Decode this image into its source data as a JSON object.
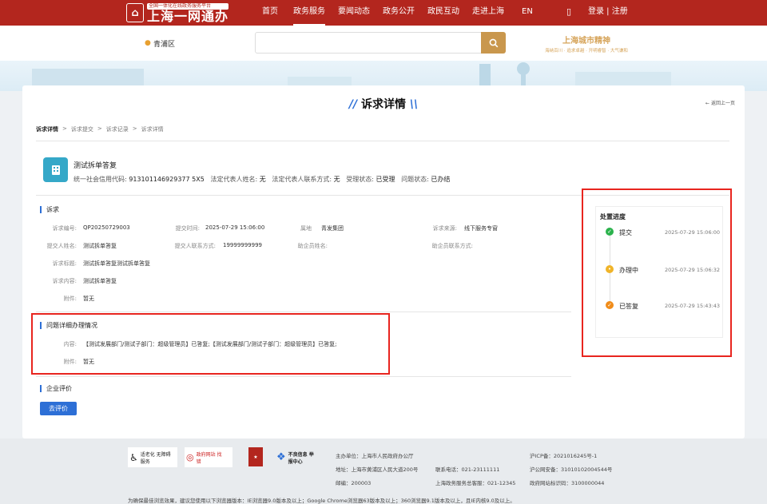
{
  "header": {
    "logo_small": "全国一体化在线政务服务平台",
    "logo_title": "上海一网通办",
    "nav": [
      "首页",
      "政务服务",
      "要闻动态",
      "政务公开",
      "政民互动",
      "走进上海",
      "EN"
    ],
    "nav_active": "政务服务",
    "login": "登录 | 注册"
  },
  "search": {
    "location": "青浦区",
    "placeholder": "",
    "slogan_title": "上海城市精神",
    "slogan_sub": "海纳百川 · 追求卓越 · 开明睿智 · 大气谦和"
  },
  "page": {
    "title": "诉求详情",
    "back": "返回上一页",
    "breadcrumbs": [
      "诉求详情",
      ">",
      "诉求提交",
      ">",
      "诉求记录",
      ">",
      "诉求详情"
    ]
  },
  "company": {
    "name": "测试拆单答复",
    "credit_code_label": "统一社会信用代码:",
    "credit_code": "913101146929377 5X5",
    "legal_name_label": "法定代表人姓名:",
    "legal_name": "无",
    "legal_contact_label": "法定代表人联系方式:",
    "legal_contact": "无",
    "accept_status_label": "受理状态:",
    "accept_status": "已受理",
    "issue_status_label": "问题状态:",
    "issue_status": "已办结"
  },
  "appeal": {
    "section_title": "诉求",
    "rows": [
      [
        {
          "label": "诉求编号:",
          "value": "QP20250729003"
        },
        {
          "label": "提交时间:",
          "value": "2025-07-29 15:06:00"
        },
        {
          "label": "属地",
          "value": "青发集团"
        },
        {
          "label": "诉求来源:",
          "value": "线下服务专窗"
        }
      ],
      [
        {
          "label": "提交人姓名:",
          "value": "测试拆单答复"
        },
        {
          "label": "提交人联系方式:",
          "value": "19999999999"
        },
        {
          "label": "助企员姓名:",
          "value": ""
        },
        {
          "label": "助企员联系方式:",
          "value": ""
        }
      ]
    ],
    "title_label": "诉求标题:",
    "title_value": "测试拆单答复测试拆单答复",
    "content_label": "诉求内容:",
    "content_value": "测试拆单答复",
    "attach_label": "附件:",
    "attach_value": "暂无"
  },
  "detail": {
    "section_title": "问题详细办理情况",
    "content_label": "内容:",
    "content_value": "【测试发展部门/测试子部门：超级管理员】已答复;【测试发展部门/测试子部门：超级管理员】已答复;",
    "attach_label": "附件:",
    "attach_value": "暂无"
  },
  "evaluation": {
    "section_title": "企业评价",
    "button": "去评价"
  },
  "progress": {
    "title": "处置进度",
    "steps": [
      {
        "name": "提交",
        "time": "2025-07-29 15:06:00",
        "color": "#2bb24c"
      },
      {
        "name": "办理中",
        "time": "2025-07-29 15:06:32",
        "color": "#f0b429"
      },
      {
        "name": "已答复",
        "time": "2025-07-29 15:43:43",
        "color": "#f08c1a"
      }
    ]
  },
  "footer": {
    "badge_access": "适老化 无障碍服务",
    "badge_gov": "政府网站 找错",
    "badge_report": "不良信息 举报中心",
    "host": "主办单位：上海市人民政府办公厅",
    "address": "地址：上海市黄浦区人民大道200号",
    "postcode": "邮编：200003",
    "phone": "联系电话：021-23111111",
    "service": "上海政务服务总客服：021-12345",
    "icp": "沪ICP备：2021016245号-1",
    "police": "沪公网安备：31010102004544号",
    "site_id": "政府网站标识码：3100000044",
    "notice": "为确保最佳浏览效果，建议您使用以下浏览器版本：IE浏览器9.0版本及以上；Google Chrome浏览器63版本及以上；360浏览器9.1版本及以上，且IE内核9.0及以上。"
  }
}
